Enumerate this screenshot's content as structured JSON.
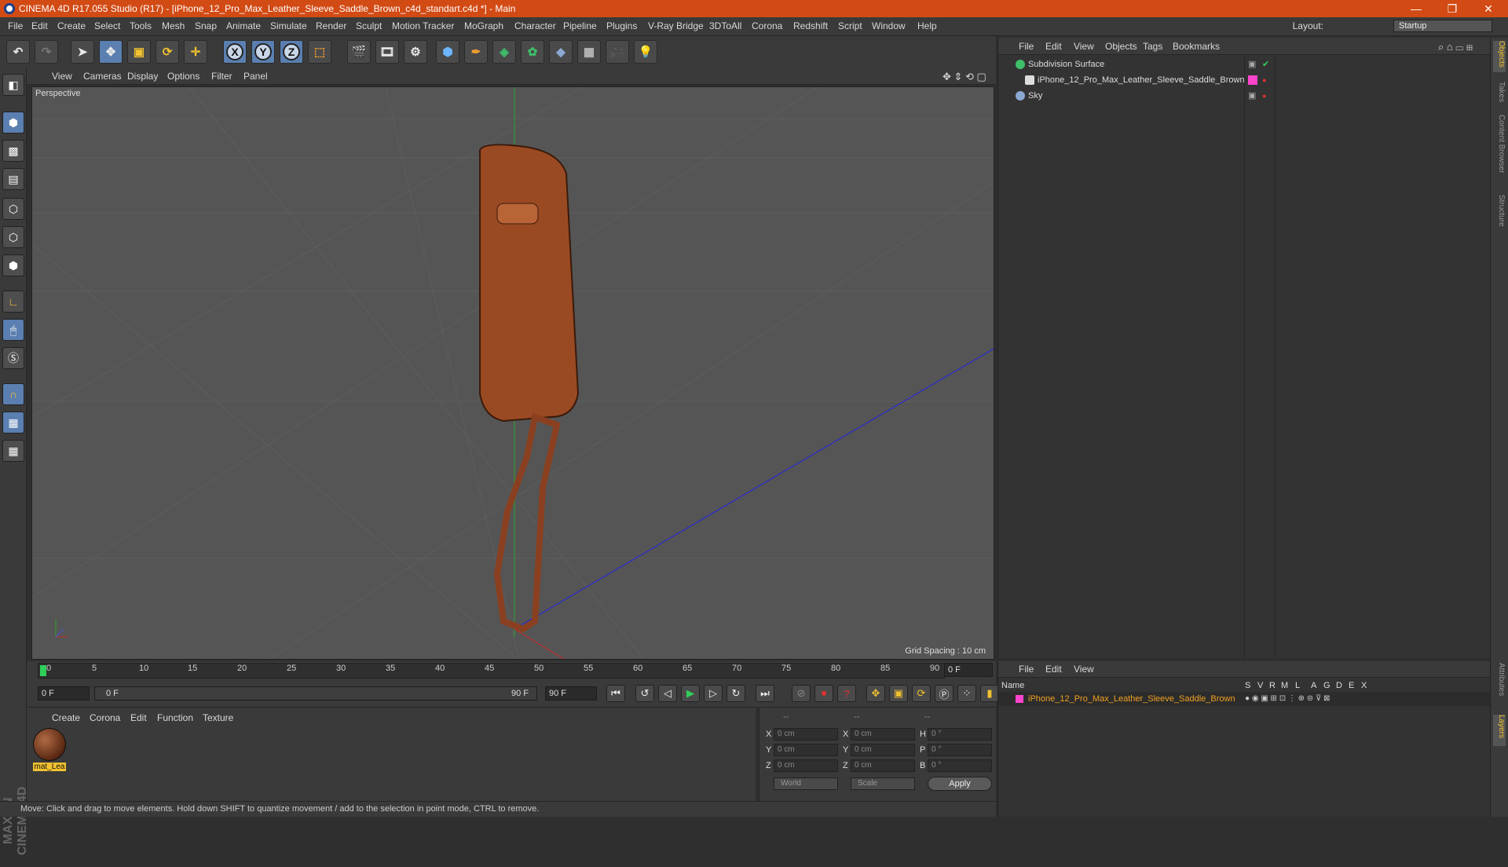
{
  "window": {
    "title": "CINEMA 4D R17.055 Studio (R17) - [iPhone_12_Pro_Max_Leather_Sleeve_Saddle_Brown_c4d_standart.c4d *] - Main",
    "minimize": "—",
    "maximize": "❐",
    "close": "✕"
  },
  "menubar": {
    "items": [
      "File",
      "Edit",
      "Create",
      "Select",
      "Tools",
      "Mesh",
      "Snap",
      "Animate",
      "Simulate",
      "Render",
      "Sculpt",
      "Motion Tracker",
      "MoGraph",
      "Character",
      "Pipeline",
      "Plugins",
      "V-Ray Bridge",
      "3DToAll",
      "Corona",
      "Redshift",
      "Script",
      "Window",
      "Help"
    ],
    "layout_label": "Layout:",
    "layout_value": "Startup"
  },
  "toolbar": {
    "axis_x": "X",
    "axis_y": "Y",
    "axis_z": "Z"
  },
  "viewport": {
    "menu": [
      "View",
      "Cameras",
      "Display",
      "Options",
      "Filter",
      "Panel"
    ],
    "label": "Perspective",
    "grid_spacing": "Grid Spacing : 10 cm"
  },
  "timeline": {
    "ticks": [
      "0",
      "5",
      "10",
      "15",
      "20",
      "25",
      "30",
      "35",
      "40",
      "45",
      "50",
      "55",
      "60",
      "65",
      "70",
      "75",
      "80",
      "85",
      "90"
    ],
    "current_frame": "0 F",
    "start_field": "0 F",
    "range_start": "0 F",
    "range_end": "90 F",
    "end_field": "90 F"
  },
  "material_panel": {
    "menu": [
      "Create",
      "Corona",
      "Edit",
      "Function",
      "Texture"
    ],
    "materials": [
      {
        "name": "mat_Lea"
      }
    ]
  },
  "coord_panel": {
    "headers": [
      "--",
      "--",
      "--"
    ],
    "rows": [
      {
        "l1": "X",
        "v1": "0 cm",
        "l2": "X",
        "v2": "0 cm",
        "l3": "H",
        "v3": "0 °"
      },
      {
        "l1": "Y",
        "v1": "0 cm",
        "l2": "Y",
        "v2": "0 cm",
        "l3": "P",
        "v3": "0 °"
      },
      {
        "l1": "Z",
        "v1": "0 cm",
        "l2": "Z",
        "v2": "0 cm",
        "l3": "B",
        "v3": "0 °"
      }
    ],
    "space": "World",
    "mode": "Scale",
    "apply": "Apply"
  },
  "status": "Move: Click and drag to move elements. Hold down SHIFT to quantize movement / add to the selection in point mode, CTRL to remove.",
  "object_manager": {
    "menu": [
      "File",
      "Edit",
      "View",
      "Objects",
      "Tags",
      "Bookmarks"
    ],
    "objects": [
      {
        "name": "Subdivision Surface",
        "color": "#3fbf6a"
      },
      {
        "name": "iPhone_12_Pro_Max_Leather_Sleeve_Saddle_Brown",
        "color": "#ff44cc"
      },
      {
        "name": "Sky",
        "color": "#8aa8d0"
      }
    ]
  },
  "layer_manager": {
    "menu": [
      "File",
      "Edit",
      "View"
    ],
    "columns": [
      "Name",
      "S",
      "V",
      "R",
      "M",
      "L",
      "A",
      "G",
      "D",
      "E",
      "X"
    ],
    "layers": [
      {
        "name": "iPhone_12_Pro_Max_Leather_Sleeve_Saddle_Brown",
        "color": "#ff44cc"
      }
    ]
  },
  "side_tabs": [
    "Objects",
    "Takes",
    "Content Browser",
    "Structure",
    "Attributes",
    "Layers"
  ],
  "brand": "MAXON CINEMA 4D"
}
